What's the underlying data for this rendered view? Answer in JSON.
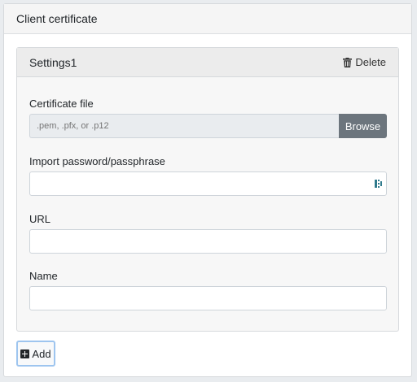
{
  "panel": {
    "title": "Client certificate"
  },
  "settings_card": {
    "title": "Settings1",
    "delete_label": "Delete",
    "certificate_file": {
      "label": "Certificate file",
      "placeholder": ".pem, .pfx, or .p12",
      "browse_label": "Browse"
    },
    "password": {
      "label": "Import password/passphrase",
      "value": ""
    },
    "url": {
      "label": "URL",
      "value": ""
    },
    "name": {
      "label": "Name",
      "value": ""
    }
  },
  "add_button": {
    "label": "Add"
  },
  "icons": {
    "delete": "trash-icon",
    "add": "plus-square-icon",
    "password_manager": "password-manager-icon"
  },
  "colors": {
    "browse_button": "#6c757d",
    "add_button_focus_ring": "#9ec5ef",
    "password_icon": "#2f7a8c"
  }
}
